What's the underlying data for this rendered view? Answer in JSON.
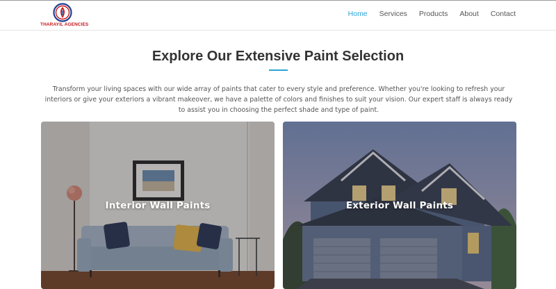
{
  "brand": {
    "name": "THARAYIL AGENCIES"
  },
  "nav": {
    "items": [
      {
        "label": "Home",
        "active": true
      },
      {
        "label": "Services",
        "active": false
      },
      {
        "label": "Products",
        "active": false
      },
      {
        "label": "About",
        "active": false
      },
      {
        "label": "Contact",
        "active": false
      }
    ]
  },
  "intro": {
    "title": "Explore Our Extensive Paint Selection",
    "description": "Transform your living spaces with our wide array of paints that cater to every style and preference. Whether you're looking to refresh your interiors or give your exteriors a vibrant makeover, we have a palette of colors and finishes to suit your vision. Our expert staff is always ready to assist you in choosing the perfect shade and type of paint."
  },
  "cards": [
    {
      "label": "Interior Wall Paints",
      "image": "living-room-sofa-photo"
    },
    {
      "label": "Exterior Wall Paints",
      "image": "house-exterior-photo"
    }
  ],
  "colors": {
    "accent": "#2ba3d6",
    "brand": "#c4161c",
    "heading": "#333333"
  }
}
